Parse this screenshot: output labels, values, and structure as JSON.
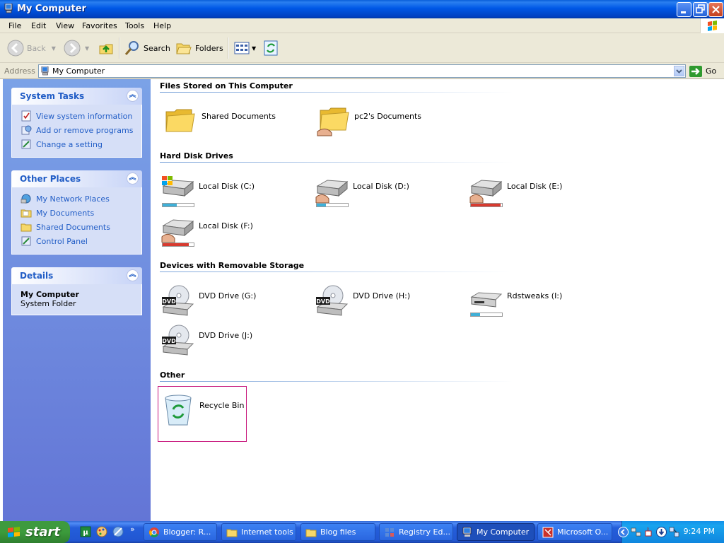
{
  "window": {
    "title": "My Computer",
    "icon": "my-computer-icon"
  },
  "menu": [
    "File",
    "Edit",
    "View",
    "Favorites",
    "Tools",
    "Help"
  ],
  "toolbar": {
    "back_label": "Back",
    "search_label": "Search",
    "folders_label": "Folders"
  },
  "address": {
    "label": "Address",
    "value": "My Computer",
    "go_label": "Go"
  },
  "sidebar": {
    "system_tasks": {
      "title": "System Tasks",
      "links": [
        "View system information",
        "Add or remove programs",
        "Change a setting"
      ]
    },
    "other_places": {
      "title": "Other Places",
      "links": [
        "My Network Places",
        "My Documents",
        "Shared Documents",
        "Control Panel"
      ]
    },
    "details": {
      "title": "Details",
      "name": "My Computer",
      "type": "System Folder"
    }
  },
  "groups": {
    "files_stored": {
      "title": "Files Stored on This Computer",
      "items": [
        "Shared Documents",
        "pc2's Documents"
      ]
    },
    "hard_disks": {
      "title": "Hard Disk Drives",
      "items": [
        {
          "label": "Local Disk (C:)",
          "used": 0.45,
          "color": "#3fb0d8"
        },
        {
          "label": "Local Disk (D:)",
          "used": 0.3,
          "color": "#3fb0d8"
        },
        {
          "label": "Local Disk (E:)",
          "used": 0.95,
          "color": "#d83a2f"
        },
        {
          "label": "Local Disk (F:)",
          "used": 0.85,
          "color": "#d83a2f"
        }
      ]
    },
    "removable": {
      "title": "Devices with Removable Storage",
      "items": [
        {
          "label": "DVD Drive (G:)"
        },
        {
          "label": "DVD Drive (H:)"
        },
        {
          "label": "Rdstweaks (I:)",
          "used": 0.3,
          "color": "#3fb0d8"
        },
        {
          "label": "DVD Drive (J:)"
        }
      ]
    },
    "other": {
      "title": "Other",
      "items": [
        "Recycle Bin"
      ]
    }
  },
  "taskbar": {
    "start_label": "start",
    "tasks": [
      "Blogger: R...",
      "Internet tools",
      "Blog files",
      "Registry Ed...",
      "My Computer",
      "Microsoft O..."
    ],
    "clock": "9:24 PM"
  },
  "colors": {
    "title_blue": "#0054e3",
    "link_blue": "#215dc6",
    "task_pane": "#6375d6",
    "selection_border": "#c8187d"
  }
}
